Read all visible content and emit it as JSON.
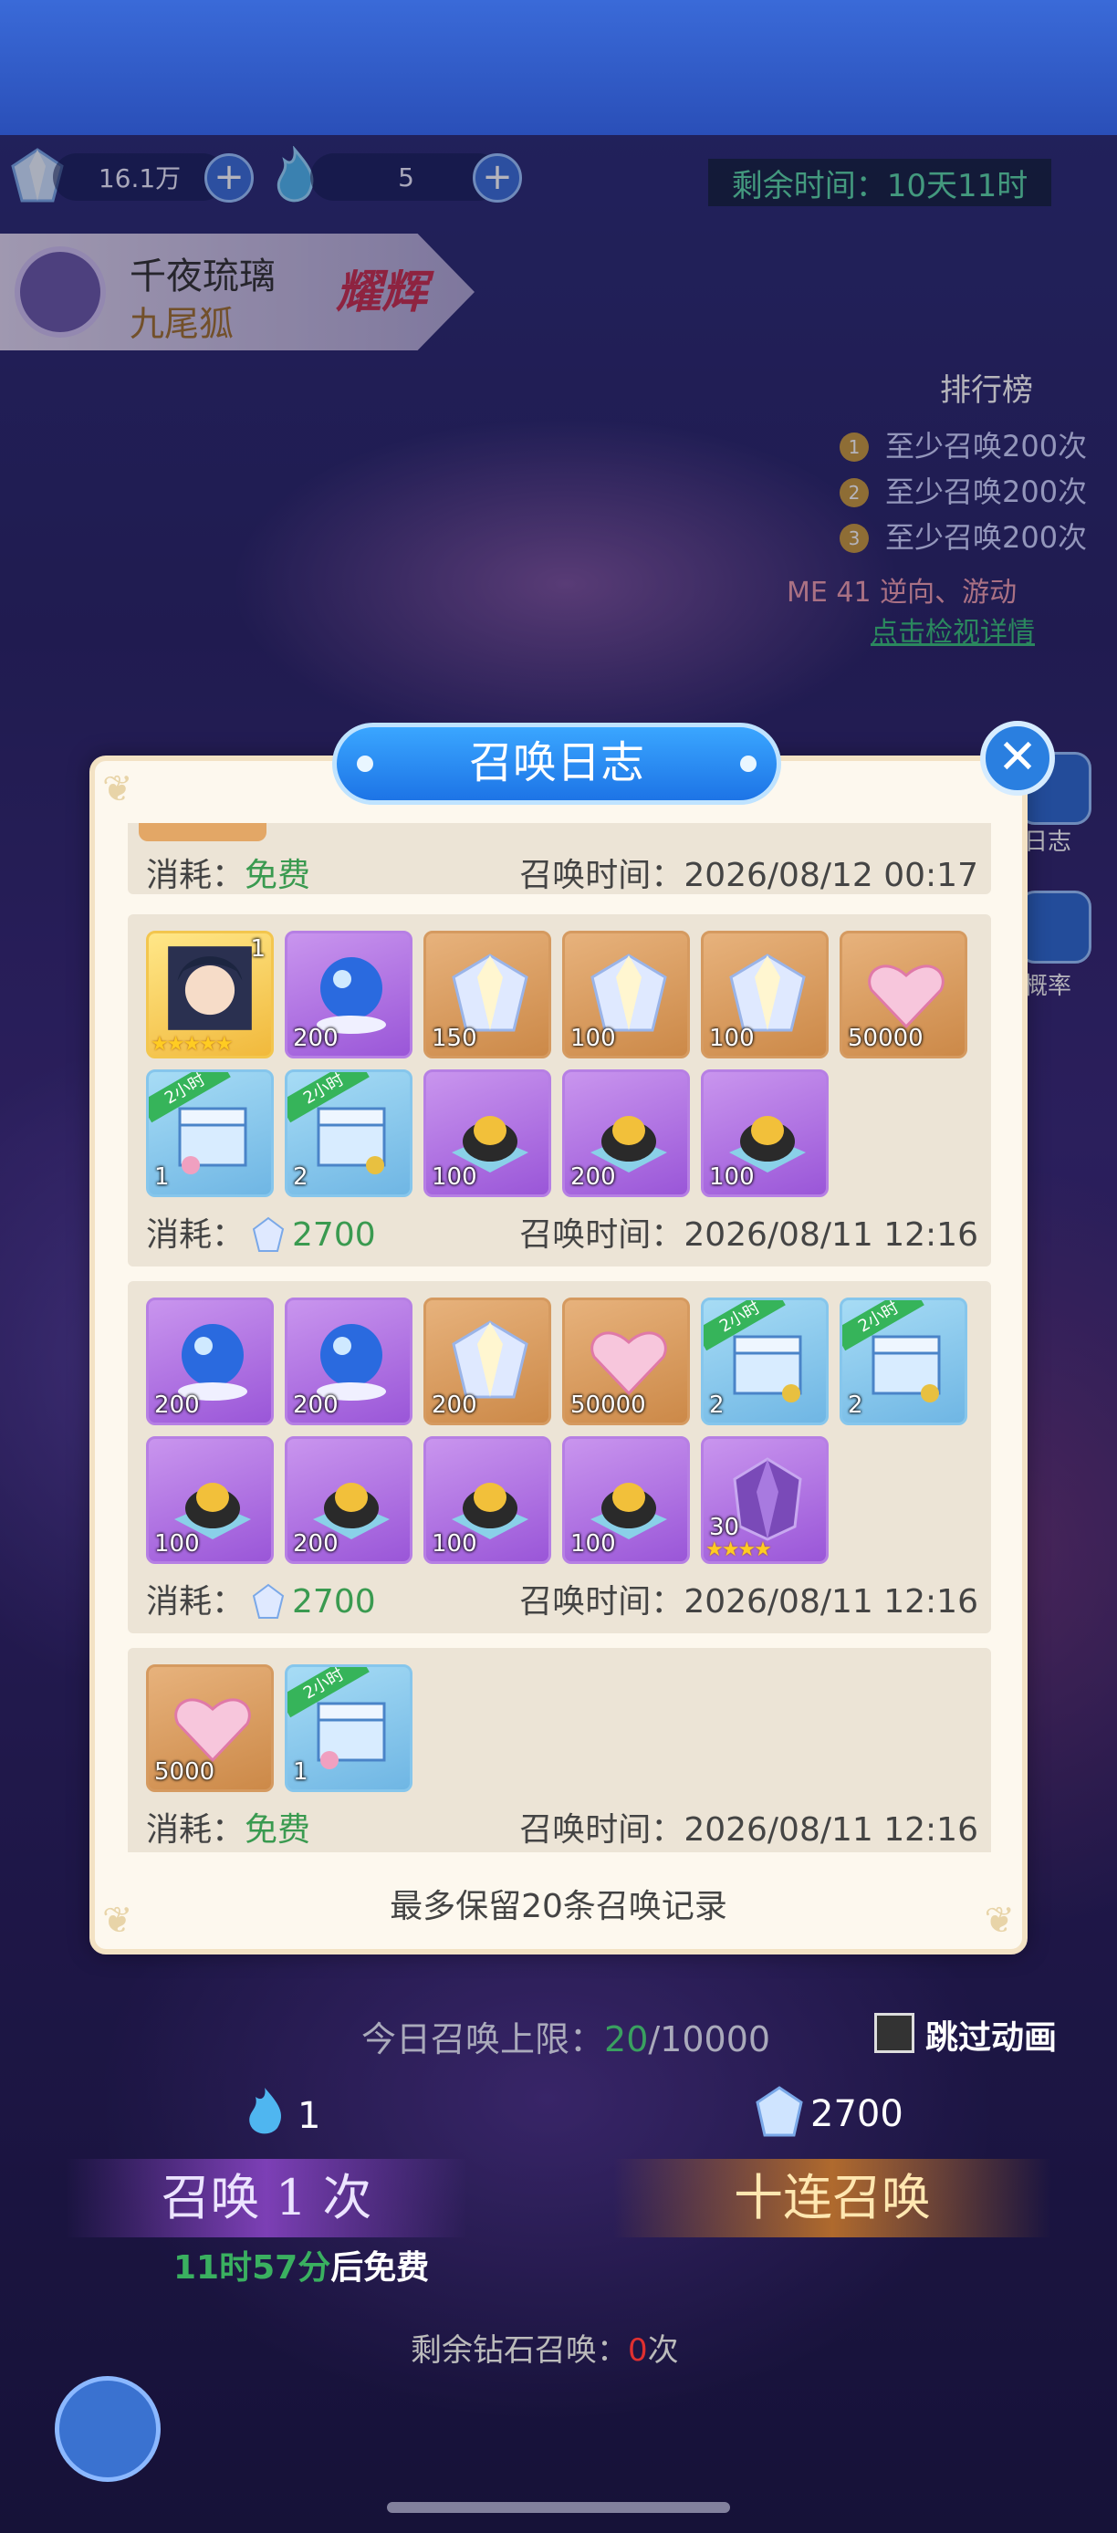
{
  "status": {
    "resource1_value": "16.1万",
    "resource2_value": "5",
    "remaining_time": "剩余时间：10天11时"
  },
  "hero": {
    "name": "千夜琉璃",
    "subtitle": "九尾狐",
    "badge": "耀辉"
  },
  "ranking": {
    "title": "排行榜",
    "items": [
      {
        "rank": "1",
        "text": "至少召唤200次"
      },
      {
        "rank": "2",
        "text": "至少召唤200次"
      },
      {
        "rank": "3",
        "text": "至少召唤200次"
      }
    ],
    "me": "ME 41  逆向、游动",
    "detail_link": "点击检视详情"
  },
  "side": {
    "log_label": "日志",
    "rate_label": "概率"
  },
  "modal": {
    "title": "召唤日志",
    "close_icon": "close-icon",
    "footer": "最多保留20条召唤记录",
    "entries": [
      {
        "cost_label": "消耗：",
        "cost_value": "免费",
        "time_label": "召唤时间：",
        "time_value": "2026/08/12 00:17"
      },
      {
        "cost_label": "消耗：",
        "cost_value": "2700",
        "time_label": "召唤时间：",
        "time_value": "2026/08/11 12:16",
        "items": [
          {
            "type": "hero-card",
            "qty": "1",
            "stars": "★★★★★"
          },
          {
            "type": "crystal-ball",
            "qty": "200"
          },
          {
            "type": "diamond",
            "qty": "150"
          },
          {
            "type": "diamond",
            "qty": "100"
          },
          {
            "type": "diamond",
            "qty": "100"
          },
          {
            "type": "exp-heart",
            "qty": "50000"
          },
          {
            "type": "treasure-chest",
            "qty": "1",
            "ribbon": "2小时"
          },
          {
            "type": "treasure-chest",
            "qty": "2",
            "ribbon": "2小时"
          },
          {
            "type": "gold-ore",
            "qty": "100"
          },
          {
            "type": "gold-ore",
            "qty": "200"
          },
          {
            "type": "gold-ore",
            "qty": "100"
          }
        ]
      },
      {
        "cost_label": "消耗：",
        "cost_value": "2700",
        "time_label": "召唤时间：",
        "time_value": "2026/08/11 12:16",
        "items": [
          {
            "type": "crystal-ball",
            "qty": "200"
          },
          {
            "type": "crystal-ball",
            "qty": "200"
          },
          {
            "type": "diamond",
            "qty": "200"
          },
          {
            "type": "exp-heart",
            "qty": "50000"
          },
          {
            "type": "treasure-chest",
            "qty": "2",
            "ribbon": "2小时"
          },
          {
            "type": "treasure-chest",
            "qty": "2",
            "ribbon": "2小时"
          },
          {
            "type": "gold-ore",
            "qty": "100"
          },
          {
            "type": "gold-ore",
            "qty": "200"
          },
          {
            "type": "gold-ore",
            "qty": "100"
          },
          {
            "type": "gold-ore",
            "qty": "100"
          },
          {
            "type": "purple-crystal",
            "qty": "30",
            "stars": "★★★★"
          }
        ]
      },
      {
        "cost_label": "消耗：",
        "cost_value": "免费",
        "time_label": "召唤时间：",
        "time_value": "2026/08/11 12:16",
        "items": [
          {
            "type": "exp-heart",
            "qty": "5000"
          },
          {
            "type": "treasure-chest",
            "qty": "1",
            "ribbon": "2小时"
          }
        ]
      }
    ]
  },
  "summon": {
    "limit_label": "今日召唤上限：",
    "limit_used": "20",
    "limit_total": "/10000",
    "skip_label": "跳过动画",
    "cost_single": "1",
    "cost_ten": "2700",
    "btn_single": "召唤 1 次",
    "btn_ten": "十连召唤",
    "free_hours": "11时57分",
    "free_suffix": "后免费",
    "diamond_left_label": "剩余钻石召唤：",
    "diamond_left_value": "0",
    "diamond_left_unit": "次"
  }
}
